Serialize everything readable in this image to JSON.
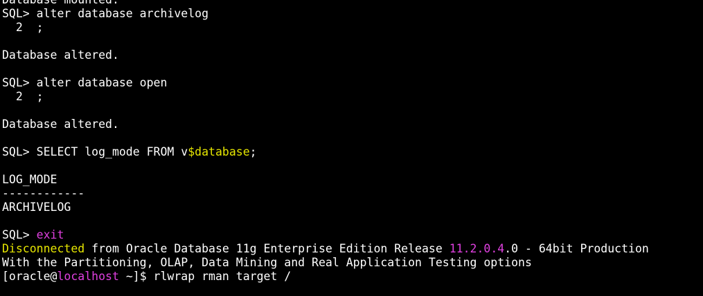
{
  "colors": {
    "background": "#000000",
    "text": "#ffffff",
    "highlight_yellow": "#e6e600",
    "highlight_magenta": "#e040e0"
  },
  "terminal": {
    "lines": [
      [
        {
          "text": "Database mounted.",
          "color": "default"
        }
      ],
      [
        {
          "text": "SQL> alter database archivelog",
          "color": "default"
        }
      ],
      [
        {
          "text": "  2  ;",
          "color": "default"
        }
      ],
      [
        {
          "text": "",
          "color": "default"
        }
      ],
      [
        {
          "text": "Database altered.",
          "color": "default"
        }
      ],
      [
        {
          "text": "",
          "color": "default"
        }
      ],
      [
        {
          "text": "SQL> alter database open",
          "color": "default"
        }
      ],
      [
        {
          "text": "  2  ;",
          "color": "default"
        }
      ],
      [
        {
          "text": "",
          "color": "default"
        }
      ],
      [
        {
          "text": "Database altered.",
          "color": "default"
        }
      ],
      [
        {
          "text": "",
          "color": "default"
        }
      ],
      [
        {
          "text": "SQL> SELECT log_mode FROM v",
          "color": "default"
        },
        {
          "text": "$database",
          "color": "yellow"
        },
        {
          "text": ";",
          "color": "default"
        }
      ],
      [
        {
          "text": "",
          "color": "default"
        }
      ],
      [
        {
          "text": "LOG_MODE",
          "color": "default"
        }
      ],
      [
        {
          "text": "------------",
          "color": "default"
        }
      ],
      [
        {
          "text": "ARCHIVELOG",
          "color": "default"
        }
      ],
      [
        {
          "text": "",
          "color": "default"
        }
      ],
      [
        {
          "text": "SQL> ",
          "color": "default"
        },
        {
          "text": "exit",
          "color": "magenta"
        }
      ],
      [
        {
          "text": "Disconnected",
          "color": "yellow"
        },
        {
          "text": " from Oracle Database 11g Enterprise Edition Release ",
          "color": "default"
        },
        {
          "text": "11.2.0.4",
          "color": "magenta"
        },
        {
          "text": ".0 - 64bit Production",
          "color": "default"
        }
      ],
      [
        {
          "text": "With the Partitioning, OLAP, Data Mining and Real Application Testing options",
          "color": "default"
        }
      ],
      [
        {
          "text": "[oracle@",
          "color": "default"
        },
        {
          "text": "localhost",
          "color": "magenta"
        },
        {
          "text": " ~]$ rlwrap rman target /",
          "color": "default"
        }
      ]
    ]
  }
}
